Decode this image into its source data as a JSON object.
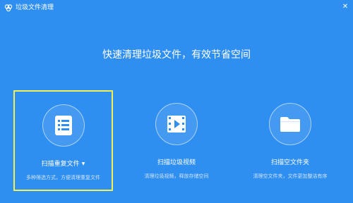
{
  "window": {
    "title": "垃圾文件清理",
    "app_icon": "cloud-icon",
    "close_icon": "close-icon",
    "close_glyph": "✕"
  },
  "headline": "快速清理垃圾文件，有效节省空间",
  "colors": {
    "background": "#2f8ff0",
    "selected_border": "#f3f056",
    "desc_text": "#cfe3fb"
  },
  "cards": [
    {
      "title": "扫描重复文件",
      "has_dropdown": true,
      "caret_glyph": "▼",
      "description": "多种筛选方式，方便清理重复文件",
      "icon": "document-list-icon",
      "selected": true
    },
    {
      "title": "扫描垃圾视频",
      "has_dropdown": false,
      "description": "清理垃圾视频，释放存储空间",
      "icon": "video-icon",
      "selected": false
    },
    {
      "title": "扫描空文件夹",
      "has_dropdown": false,
      "description": "清理空文件夹，文件更加整洁有序",
      "icon": "folder-icon",
      "selected": false
    }
  ]
}
